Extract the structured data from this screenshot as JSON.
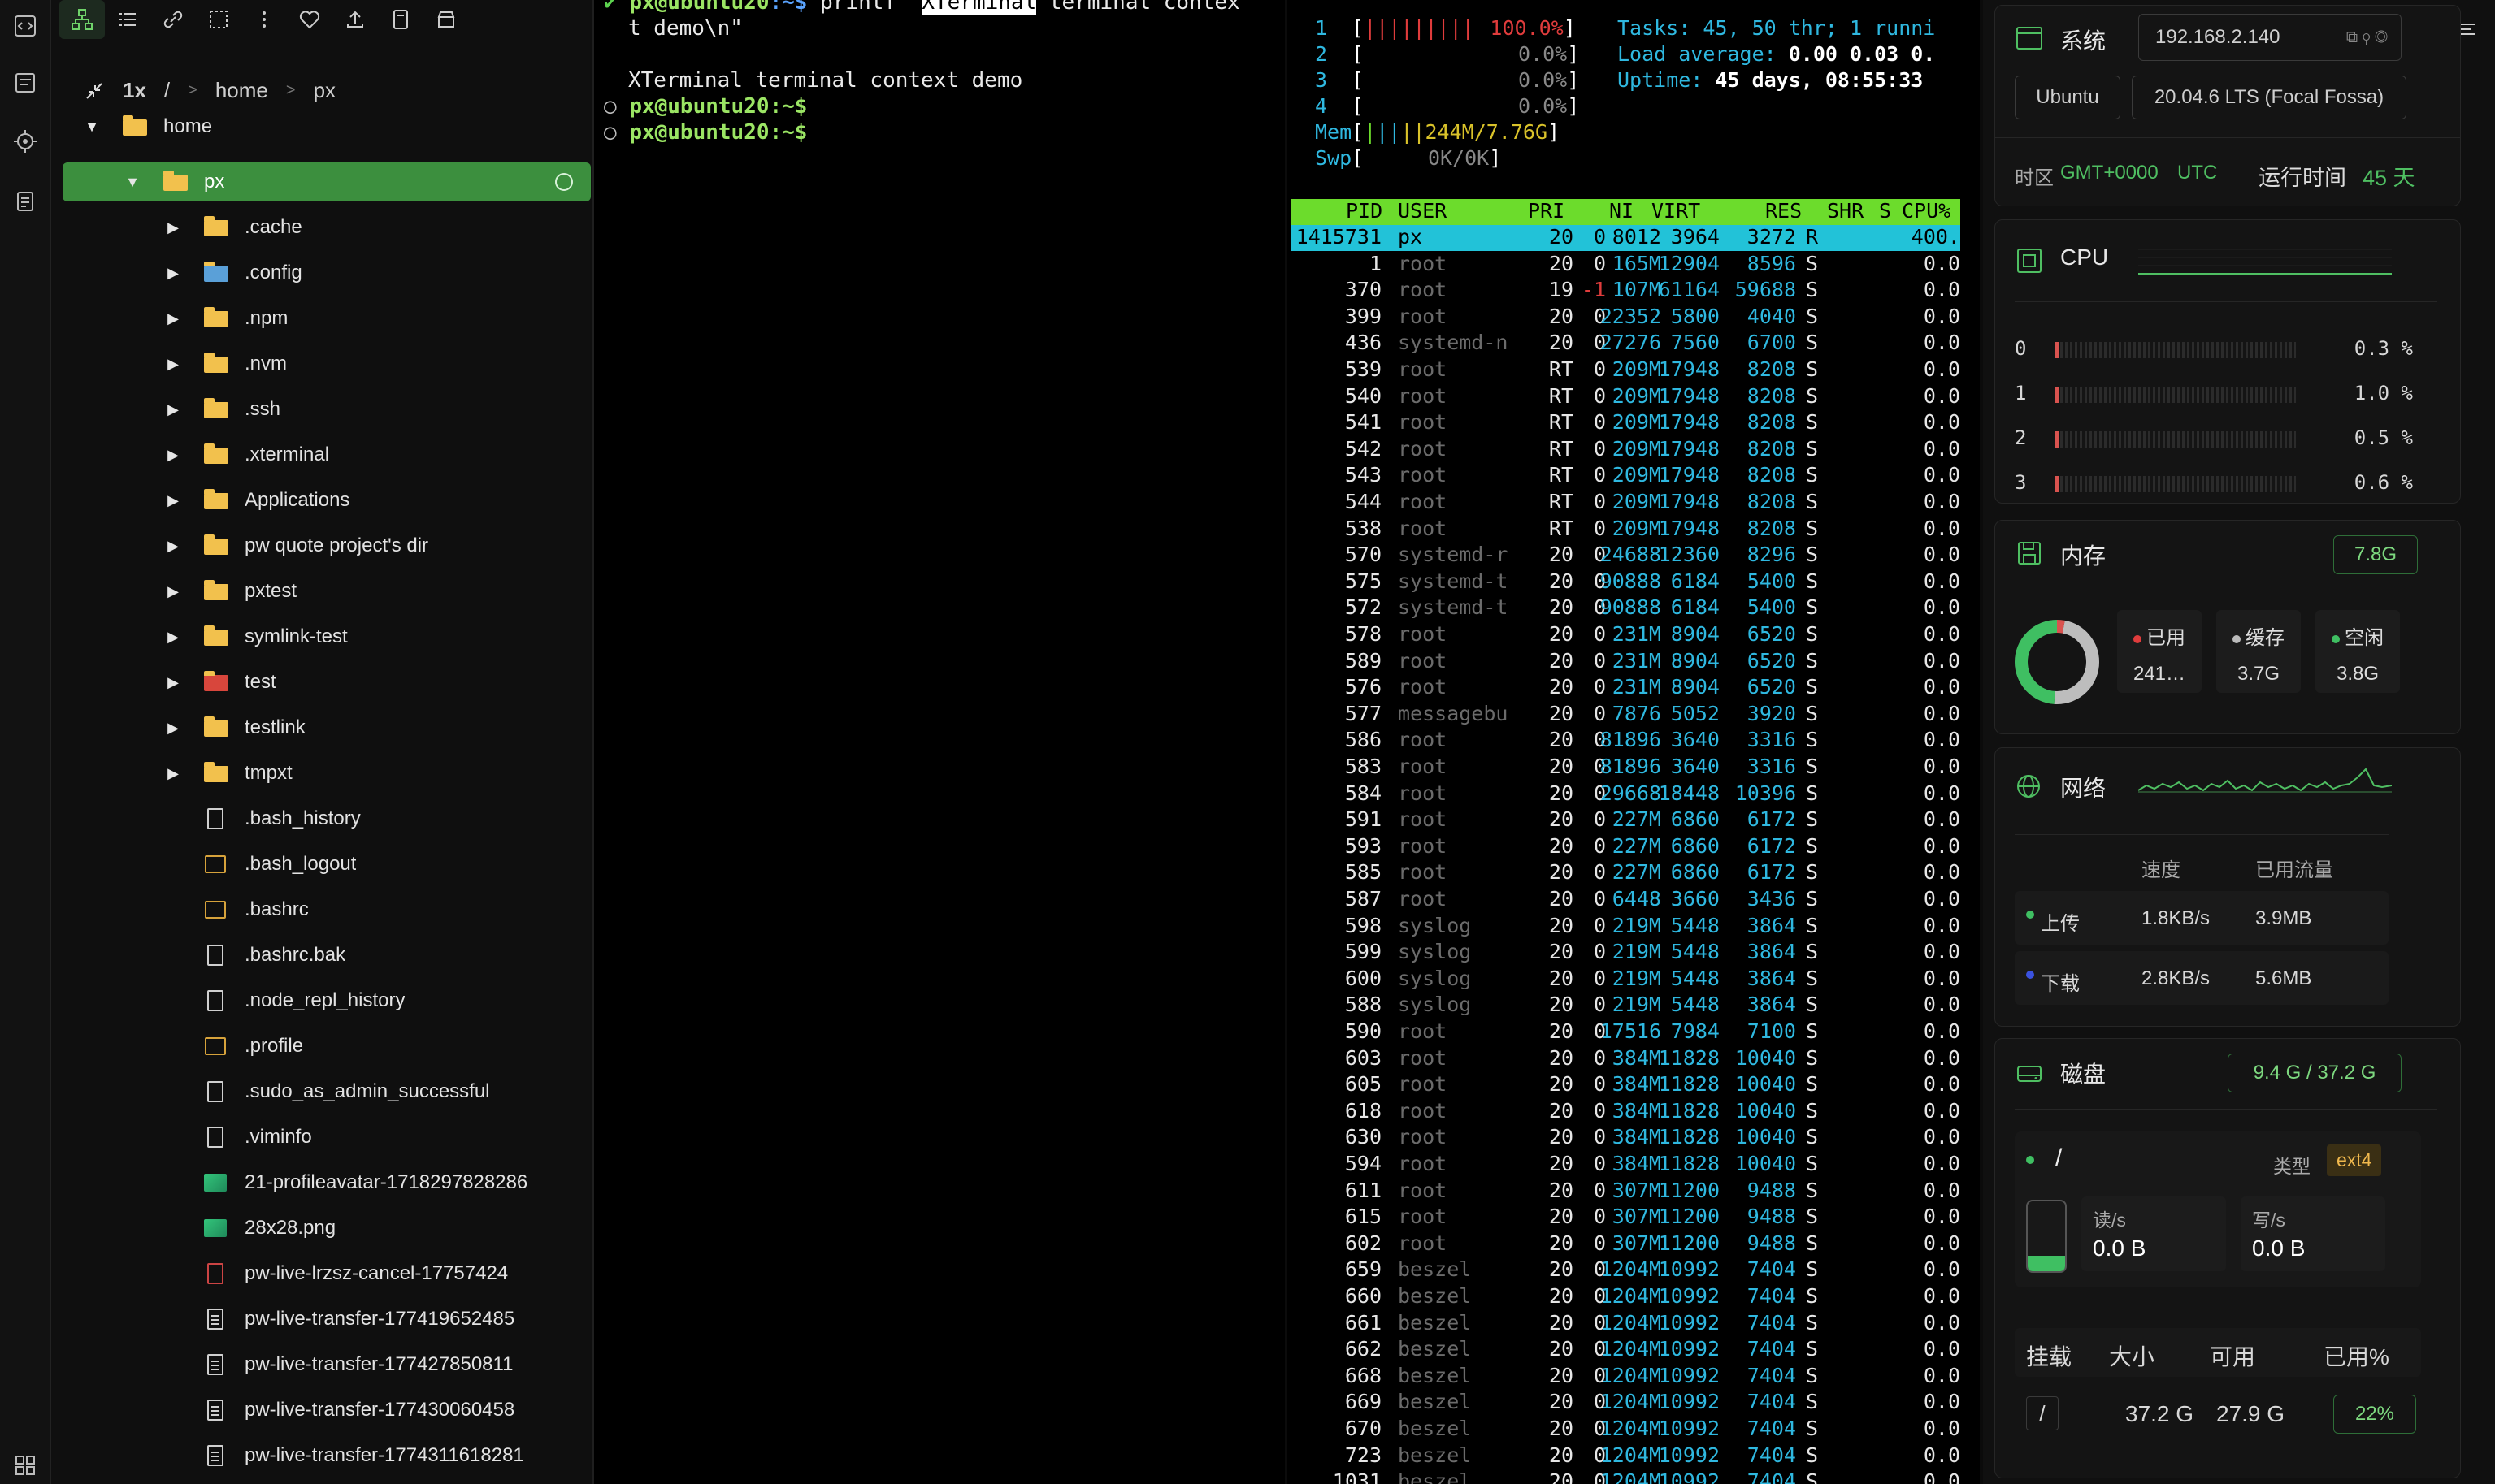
{
  "explorer": {
    "zoom": "1x",
    "path": [
      "/",
      "home",
      "px"
    ],
    "items": [
      {
        "label": "home",
        "type": "folder",
        "expand": "open",
        "level": 0
      },
      {
        "label": "px",
        "type": "folder",
        "expand": "open",
        "level": 1,
        "selected": true
      },
      {
        "label": ".cache",
        "type": "folder",
        "expand": "closed",
        "level": 2
      },
      {
        "label": ".config",
        "type": "gear-folder",
        "expand": "closed",
        "level": 2
      },
      {
        "label": ".npm",
        "type": "folder",
        "expand": "closed",
        "level": 2
      },
      {
        "label": ".nvm",
        "type": "folder",
        "expand": "closed",
        "level": 2
      },
      {
        "label": ".ssh",
        "type": "folder",
        "expand": "closed",
        "level": 2
      },
      {
        "label": ".xterminal",
        "type": "folder",
        "expand": "closed",
        "level": 2
      },
      {
        "label": "Applications",
        "type": "folder",
        "expand": "closed",
        "level": 2
      },
      {
        "label": "pw quote project's dir",
        "type": "folder",
        "expand": "closed",
        "level": 2
      },
      {
        "label": "pxtest",
        "type": "folder",
        "expand": "closed",
        "level": 2
      },
      {
        "label": "symlink-test",
        "type": "folder",
        "expand": "closed",
        "level": 2
      },
      {
        "label": "test",
        "type": "test-folder",
        "expand": "closed",
        "level": 2
      },
      {
        "label": "testlink",
        "type": "folder",
        "expand": "closed",
        "level": 2
      },
      {
        "label": "tmpxt",
        "type": "folder",
        "expand": "closed",
        "level": 2
      },
      {
        "label": ".bash_history",
        "type": "file",
        "level": 2
      },
      {
        "label": ".bash_logout",
        "type": "shell",
        "level": 2
      },
      {
        "label": ".bashrc",
        "type": "shell",
        "level": 2
      },
      {
        "label": ".bashrc.bak",
        "type": "file",
        "level": 2
      },
      {
        "label": ".node_repl_history",
        "type": "file",
        "level": 2
      },
      {
        "label": ".profile",
        "type": "shell",
        "level": 2
      },
      {
        "label": ".sudo_as_admin_successful",
        "type": "file",
        "level": 2
      },
      {
        "label": ".viminfo",
        "type": "file",
        "level": 2
      },
      {
        "label": "21-profileavatar-1718297828286",
        "type": "image",
        "level": 2
      },
      {
        "label": "28x28.png",
        "type": "image",
        "level": 2
      },
      {
        "label": "pw-live-lrzsz-cancel-17757424",
        "type": "red-file",
        "level": 2
      },
      {
        "label": "pw-live-transfer-177419652485",
        "type": "doc",
        "level": 2
      },
      {
        "label": "pw-live-transfer-177427850811",
        "type": "doc",
        "level": 2
      },
      {
        "label": "pw-live-transfer-177430060458",
        "type": "doc",
        "level": 2
      },
      {
        "label": "pw-live-transfer-1774311618281",
        "type": "doc",
        "level": 2
      }
    ]
  },
  "terminal1": {
    "cmd_user": "px@ubuntu20",
    "cmd_dir": ":~$",
    "cmd_text": " printf \"",
    "cmd_highlight": "XTerminal",
    "cmd_rest": " terminal contex",
    "cmd_wrap": "t demo\\n\"",
    "output": "XTerminal terminal context demo",
    "prompts": [
      "px@ubuntu20:~$",
      "px@ubuntu20:~$"
    ]
  },
  "htop": {
    "cpus": [
      {
        "id": "1",
        "pct": 100.0,
        "label": "100.0%"
      },
      {
        "id": "2",
        "pct": 0.0,
        "label": "0.0%"
      },
      {
        "id": "3",
        "pct": 0.0,
        "label": "0.0%"
      },
      {
        "id": "4",
        "pct": 0.0,
        "label": "0.0%"
      }
    ],
    "mem_label": "Mem",
    "mem_value": "244M/7.76G",
    "swp_label": "Swp",
    "swp_value": "0K/0K",
    "tasks_label": "Tasks:",
    "tasks": "45, 50 thr; 1 runni",
    "load_label": "Load average:",
    "load": "0.00 0.03 0.",
    "uptime_label": "Uptime:",
    "uptime": "45 days, 08:55:33",
    "columns": [
      "PID",
      "USER",
      "PRI",
      "NI",
      "VIRT",
      "RES",
      "SHR",
      "S",
      "CPU%"
    ],
    "rows": [
      [
        "1415731",
        "px",
        "20",
        "0",
        "8012",
        "3964",
        "3272",
        "R",
        "400."
      ],
      [
        "1",
        "root",
        "20",
        "0",
        "165M",
        "12904",
        "8596",
        "S",
        "0.0"
      ],
      [
        "370",
        "root",
        "19",
        "-1",
        "107M",
        "61164",
        "59688",
        "S",
        "0.0"
      ],
      [
        "399",
        "root",
        "20",
        "0",
        "22352",
        "5800",
        "4040",
        "S",
        "0.0"
      ],
      [
        "436",
        "systemd-n",
        "20",
        "0",
        "27276",
        "7560",
        "6700",
        "S",
        "0.0"
      ],
      [
        "539",
        "root",
        "RT",
        "0",
        "209M",
        "17948",
        "8208",
        "S",
        "0.0"
      ],
      [
        "540",
        "root",
        "RT",
        "0",
        "209M",
        "17948",
        "8208",
        "S",
        "0.0"
      ],
      [
        "541",
        "root",
        "RT",
        "0",
        "209M",
        "17948",
        "8208",
        "S",
        "0.0"
      ],
      [
        "542",
        "root",
        "RT",
        "0",
        "209M",
        "17948",
        "8208",
        "S",
        "0.0"
      ],
      [
        "543",
        "root",
        "RT",
        "0",
        "209M",
        "17948",
        "8208",
        "S",
        "0.0"
      ],
      [
        "544",
        "root",
        "RT",
        "0",
        "209M",
        "17948",
        "8208",
        "S",
        "0.0"
      ],
      [
        "538",
        "root",
        "RT",
        "0",
        "209M",
        "17948",
        "8208",
        "S",
        "0.0"
      ],
      [
        "570",
        "systemd-r",
        "20",
        "0",
        "24688",
        "12360",
        "8296",
        "S",
        "0.0"
      ],
      [
        "575",
        "systemd-t",
        "20",
        "0",
        "90888",
        "6184",
        "5400",
        "S",
        "0.0"
      ],
      [
        "572",
        "systemd-t",
        "20",
        "0",
        "90888",
        "6184",
        "5400",
        "S",
        "0.0"
      ],
      [
        "578",
        "root",
        "20",
        "0",
        "231M",
        "8904",
        "6520",
        "S",
        "0.0"
      ],
      [
        "589",
        "root",
        "20",
        "0",
        "231M",
        "8904",
        "6520",
        "S",
        "0.0"
      ],
      [
        "576",
        "root",
        "20",
        "0",
        "231M",
        "8904",
        "6520",
        "S",
        "0.0"
      ],
      [
        "577",
        "messagebu",
        "20",
        "0",
        "7876",
        "5052",
        "3920",
        "S",
        "0.0"
      ],
      [
        "586",
        "root",
        "20",
        "0",
        "81896",
        "3640",
        "3316",
        "S",
        "0.0"
      ],
      [
        "583",
        "root",
        "20",
        "0",
        "81896",
        "3640",
        "3316",
        "S",
        "0.0"
      ],
      [
        "584",
        "root",
        "20",
        "0",
        "29668",
        "18448",
        "10396",
        "S",
        "0.0"
      ],
      [
        "591",
        "root",
        "20",
        "0",
        "227M",
        "6860",
        "6172",
        "S",
        "0.0"
      ],
      [
        "593",
        "root",
        "20",
        "0",
        "227M",
        "6860",
        "6172",
        "S",
        "0.0"
      ],
      [
        "585",
        "root",
        "20",
        "0",
        "227M",
        "6860",
        "6172",
        "S",
        "0.0"
      ],
      [
        "587",
        "root",
        "20",
        "0",
        "6448",
        "3660",
        "3436",
        "S",
        "0.0"
      ],
      [
        "598",
        "syslog",
        "20",
        "0",
        "219M",
        "5448",
        "3864",
        "S",
        "0.0"
      ],
      [
        "599",
        "syslog",
        "20",
        "0",
        "219M",
        "5448",
        "3864",
        "S",
        "0.0"
      ],
      [
        "600",
        "syslog",
        "20",
        "0",
        "219M",
        "5448",
        "3864",
        "S",
        "0.0"
      ],
      [
        "588",
        "syslog",
        "20",
        "0",
        "219M",
        "5448",
        "3864",
        "S",
        "0.0"
      ],
      [
        "590",
        "root",
        "20",
        "0",
        "17516",
        "7984",
        "7100",
        "S",
        "0.0"
      ],
      [
        "603",
        "root",
        "20",
        "0",
        "384M",
        "11828",
        "10040",
        "S",
        "0.0"
      ],
      [
        "605",
        "root",
        "20",
        "0",
        "384M",
        "11828",
        "10040",
        "S",
        "0.0"
      ],
      [
        "618",
        "root",
        "20",
        "0",
        "384M",
        "11828",
        "10040",
        "S",
        "0.0"
      ],
      [
        "630",
        "root",
        "20",
        "0",
        "384M",
        "11828",
        "10040",
        "S",
        "0.0"
      ],
      [
        "594",
        "root",
        "20",
        "0",
        "384M",
        "11828",
        "10040",
        "S",
        "0.0"
      ],
      [
        "611",
        "root",
        "20",
        "0",
        "307M",
        "11200",
        "9488",
        "S",
        "0.0"
      ],
      [
        "615",
        "root",
        "20",
        "0",
        "307M",
        "11200",
        "9488",
        "S",
        "0.0"
      ],
      [
        "602",
        "root",
        "20",
        "0",
        "307M",
        "11200",
        "9488",
        "S",
        "0.0"
      ],
      [
        "659",
        "beszel",
        "20",
        "0",
        "1204M",
        "10992",
        "7404",
        "S",
        "0.0"
      ],
      [
        "660",
        "beszel",
        "20",
        "0",
        "1204M",
        "10992",
        "7404",
        "S",
        "0.0"
      ],
      [
        "661",
        "beszel",
        "20",
        "0",
        "1204M",
        "10992",
        "7404",
        "S",
        "0.0"
      ],
      [
        "662",
        "beszel",
        "20",
        "0",
        "1204M",
        "10992",
        "7404",
        "S",
        "0.0"
      ],
      [
        "668",
        "beszel",
        "20",
        "0",
        "1204M",
        "10992",
        "7404",
        "S",
        "0.0"
      ],
      [
        "669",
        "beszel",
        "20",
        "0",
        "1204M",
        "10992",
        "7404",
        "S",
        "0.0"
      ],
      [
        "670",
        "beszel",
        "20",
        "0",
        "1204M",
        "10992",
        "7404",
        "S",
        "0.0"
      ],
      [
        "723",
        "beszel",
        "20",
        "0",
        "1204M",
        "10992",
        "7404",
        "S",
        "0.0"
      ],
      [
        "1031",
        "beszel",
        "20",
        "0",
        "1204M",
        "10992",
        "7404",
        "S",
        "0.0"
      ]
    ]
  },
  "info": {
    "system": {
      "title": "系统",
      "ip": "192.168.2.140",
      "os": "Ubuntu",
      "version": "20.04.6 LTS (Focal Fossa)",
      "tz_label": "时区",
      "tz_value": "GMT+0000",
      "tz_name": "UTC",
      "uptime_label": "运行时间",
      "uptime_value": "45 天"
    },
    "cpu": {
      "title": "CPU",
      "cores": [
        {
          "id": "0",
          "pct": 0.3,
          "label": "0.3 %"
        },
        {
          "id": "1",
          "pct": 1.0,
          "label": "1.0 %"
        },
        {
          "id": "2",
          "pct": 0.5,
          "label": "0.5 %"
        },
        {
          "id": "3",
          "pct": 0.6,
          "label": "0.6 %"
        }
      ]
    },
    "memory": {
      "title": "内存",
      "total": "7.8G",
      "used_label": "已用",
      "used": "241…",
      "cache_label": "缓存",
      "cache": "3.7G",
      "free_label": "空闲",
      "free": "3.8G",
      "used_fraction": 0.03,
      "cache_fraction": 0.48
    },
    "network": {
      "title": "网络",
      "speed_col": "速度",
      "traffic_col": "已用流量",
      "up_label": "上传",
      "up_speed": "1.8KB/s",
      "up_total": "3.9MB",
      "down_label": "下载",
      "down_speed": "2.8KB/s",
      "down_total": "5.6MB"
    },
    "disk": {
      "title": "磁盘",
      "usage": "9.4 G / 37.2 G",
      "mount": "/",
      "type_label": "类型",
      "type_value": "ext4",
      "read_label": "读/s",
      "read_value": "0.0 B",
      "write_label": "写/s",
      "write_value": "0.0 B",
      "th_mount": "挂载",
      "th_size": "大小",
      "th_avail": "可用",
      "th_used": "已用%",
      "row_mount": "/",
      "row_size": "37.2 G",
      "row_avail": "27.9 G",
      "row_used": "22%",
      "used_fraction": 0.22
    }
  },
  "colors": {
    "accent": "#3c8f3e",
    "htop_header": "#6cdc2c",
    "htop_selected": "#22c2d8",
    "htop_value": "#2fb8e0",
    "terminal_prompt_user": "#9be564",
    "terminal_prompt_dir": "#5ba4ff"
  }
}
